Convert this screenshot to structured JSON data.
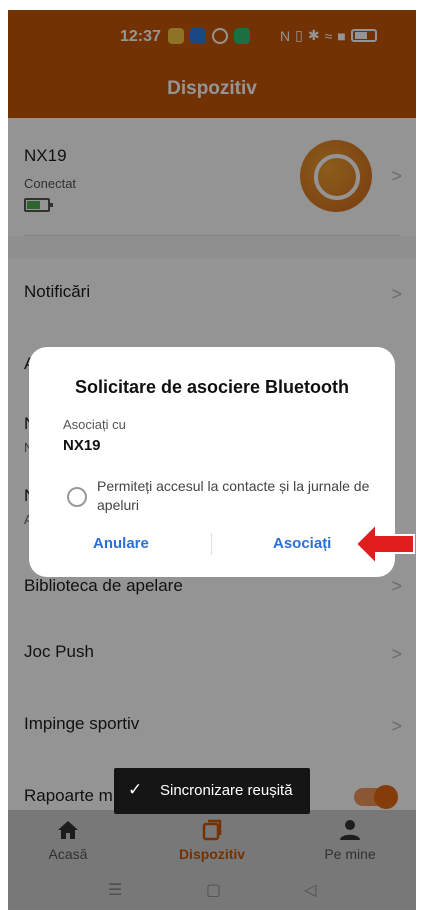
{
  "status": {
    "time": "12:37"
  },
  "header": {
    "title": "Dispozitiv"
  },
  "device": {
    "name": "NX19",
    "status": "Conectat"
  },
  "rows": [
    {
      "label": "Notificări",
      "sub": ""
    },
    {
      "label": "A",
      "sub": ""
    },
    {
      "label": "N",
      "sub": "N"
    },
    {
      "label": "N",
      "sub": "A"
    },
    {
      "label": "Biblioteca de apelare",
      "sub": ""
    },
    {
      "label": "Joc Push",
      "sub": ""
    },
    {
      "label": "Impinge sportiv",
      "sub": ""
    },
    {
      "label": "Rapoarte m",
      "sub": ""
    }
  ],
  "chevron": ">",
  "dialog": {
    "title": "Solicitare de asociere Bluetooth",
    "pair_with_label": "Asociați cu",
    "device_name": "NX19",
    "permission_text": "Permiteți accesul la contacte și la jurnale de apeluri",
    "cancel_label": "Anulare",
    "pair_label": "Asociați"
  },
  "toast": {
    "check": "✓",
    "text": "Sincronizare reușită"
  },
  "nav": [
    {
      "label": "Acasă",
      "icon": "home-icon"
    },
    {
      "label": "Dispozitiv",
      "icon": "device-icon"
    },
    {
      "label": "Pe mine",
      "icon": "person-icon"
    }
  ],
  "system_nav": {
    "menu": "☰",
    "home": "▢",
    "back": "◁"
  },
  "colors": {
    "primary": "#c75707",
    "accent_orange": "#e36a12",
    "dialog_button": "#2b6fd8",
    "arrow": "#e01e1e"
  }
}
